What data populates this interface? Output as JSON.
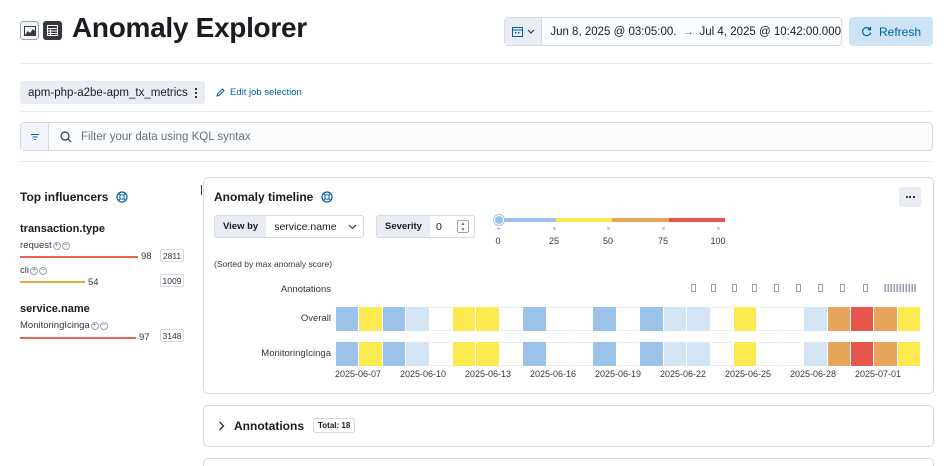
{
  "header": {
    "title": "Anomaly Explorer",
    "icons": [
      "chart-icon",
      "table-icon"
    ],
    "date_start": "Jun 8, 2025 @ 03:05:00.0...",
    "date_arrow": "→",
    "date_end": "Jul 4, 2025 @ 10:42:00.000",
    "refresh_label": "Refresh"
  },
  "job": {
    "id": "apm-php-a2be-apm_tx_metrics",
    "edit_label": "Edit job selection"
  },
  "search": {
    "placeholder": "Filter your data using KQL syntax"
  },
  "influencers": {
    "title": "Top influencers",
    "groups": [
      {
        "field": "transaction.type",
        "items": [
          {
            "label": "request",
            "score": "98",
            "count": "2811",
            "fraction": 0.98,
            "color": "#e7664c"
          },
          {
            "label": "cli",
            "score": "54",
            "count": "1009",
            "fraction": 0.54,
            "color": "#e7a93c"
          }
        ]
      },
      {
        "field": "service.name",
        "items": [
          {
            "label": "MonitoringIcinga",
            "score": "97",
            "count": "3148",
            "fraction": 0.97,
            "color": "#e7664c"
          }
        ]
      }
    ]
  },
  "timeline": {
    "title": "Anomaly timeline",
    "view_by_label": "View by",
    "view_by_value": "service.name",
    "severity_label": "Severity",
    "severity_value": "0",
    "severity_ticks": [
      "0",
      "25",
      "50",
      "75",
      "100"
    ],
    "severity_colors": [
      "#9bc3ea",
      "#fce950",
      "#e7a55c",
      "#e7564c"
    ],
    "sorted_note": "(Sorted by max anomaly score)",
    "annotations_row_label": "Annotations",
    "rows": [
      {
        "label": "Overall",
        "cells": [
          "#9bc3ea",
          "#fce950",
          "#9bc3ea",
          "#d3e5f5",
          "",
          "#fce950",
          "#fce950",
          "",
          "#9bc3ea",
          "",
          "",
          "#9bc3ea",
          "",
          "#9bc3ea",
          "#d3e5f5",
          "#d3e5f5",
          "",
          "#fce950",
          "",
          "",
          "#d3e5f5",
          "#e7a55c",
          "#e7564c",
          "#e7a55c",
          "#fce950"
        ]
      },
      {
        "label": "MonitoringIcinga",
        "cells": [
          "#9bc3ea",
          "#fce950",
          "#9bc3ea",
          "#d3e5f5",
          "",
          "#fce950",
          "#fce950",
          "",
          "#9bc3ea",
          "",
          "",
          "#9bc3ea",
          "",
          "#9bc3ea",
          "#d3e5f5",
          "#d3e5f5",
          "",
          "#fce950",
          "",
          "",
          "#d3e5f5",
          "#e7a55c",
          "#e7564c",
          "#e7a55c",
          "#fce950"
        ]
      }
    ],
    "dates": [
      "2025-06-07",
      "2025-06-10",
      "2025-06-13",
      "2025-06-16",
      "2025-06-19",
      "2025-06-22",
      "2025-06-25",
      "2025-06-28",
      "2025-07-01"
    ]
  },
  "annotations": {
    "title": "Annotations",
    "total": "Total: 18"
  }
}
